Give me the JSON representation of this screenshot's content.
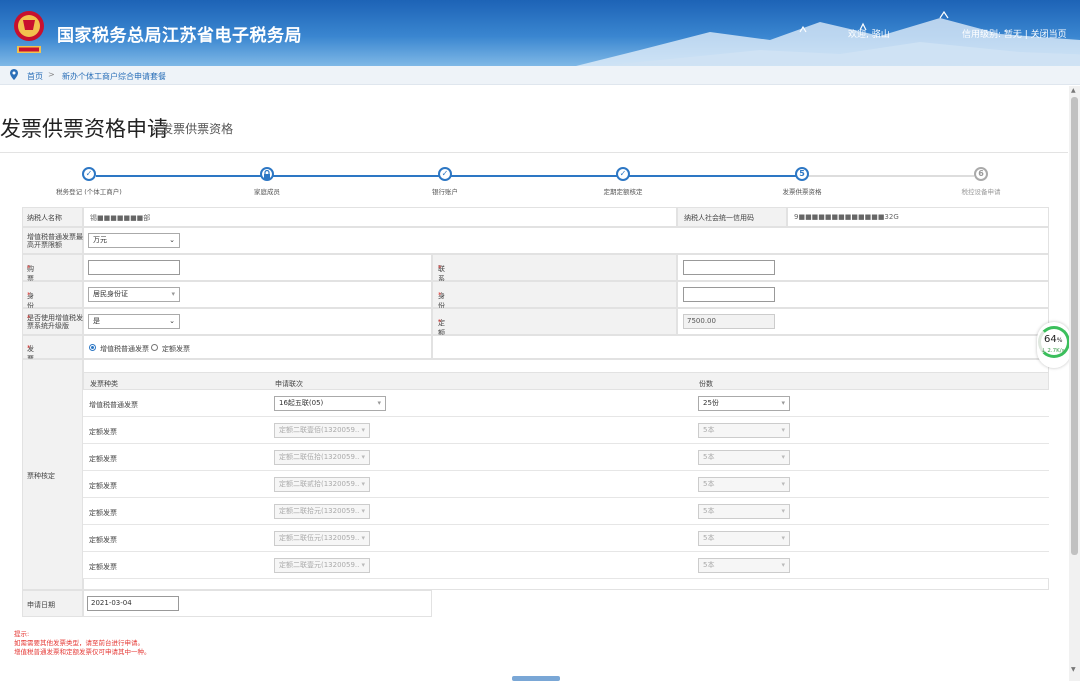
{
  "header": {
    "site_title": "国家税务总局江苏省电子税务局",
    "welcome": "欢迎, 骆山",
    "right_links": "信用级别: 暂无 | 关闭当页"
  },
  "breadcrumb": {
    "home": "首页",
    "separator": ">",
    "current": "新办个体工商户综合申请套餐"
  },
  "page": {
    "title": "发票供票资格申请",
    "subtitle": "» 发票供票资格"
  },
  "steps": [
    {
      "label": "税务登记 (个体工商户)",
      "mark": "✓",
      "status": "done"
    },
    {
      "label": "家庭成员",
      "mark": "🔒",
      "status": "done"
    },
    {
      "label": "银行账户",
      "mark": "✓",
      "status": "done"
    },
    {
      "label": "定期定额核定",
      "mark": "✓",
      "status": "done"
    },
    {
      "label": "发票供票资格",
      "mark": "5",
      "status": "current"
    },
    {
      "label": "税控设备申请",
      "mark": "6",
      "status": "todo"
    }
  ],
  "form": {
    "taxpayer_name_label": "纳税人名称",
    "taxpayer_name_value": "锡■■■■■■■部",
    "credit_code_label": "纳税人社会统一信用码",
    "credit_code_value": "9■■■■■■■■■■■■■32G",
    "max_amount_label": "增值税普通发票最高开票限额",
    "max_amount_value": "万元",
    "buyer_name_label": "购票人员姓名",
    "phone_label": "联系电话",
    "id_type_label": "身份证件类型",
    "id_type_value": "居民身份证",
    "id_no_label": "身份证件号码",
    "vat_upgrade_label": "是否使用增值税发票系统升级版",
    "vat_upgrade_value": "是",
    "quota_total_label": "定额发票累计领用金额",
    "quota_total_value": "7500.00",
    "invoice_kind_label": "发票种类",
    "invoice_kind_opt1": "增值税普通发票",
    "invoice_kind_opt2": "定额发票",
    "ticket_type_label": "票种核定",
    "apply_date_label": "申请日期",
    "apply_date_value": "2021-03-04",
    "required_mark": "*"
  },
  "ticket_table": {
    "headers": [
      "发票种类",
      "申请联次",
      "份数"
    ],
    "rows": [
      {
        "kind": "增值税普通发票",
        "copies": "16起五联(05)",
        "qty": "25份",
        "disabled": false
      },
      {
        "kind": "定额发票",
        "copies": "定额二联壹佰(1320059...",
        "qty": "5本",
        "disabled": true
      },
      {
        "kind": "定额发票",
        "copies": "定额二联伍拾(1320059...",
        "qty": "5本",
        "disabled": true
      },
      {
        "kind": "定额发票",
        "copies": "定额二联贰拾(1320059...",
        "qty": "5本",
        "disabled": true
      },
      {
        "kind": "定额发票",
        "copies": "定额二联拾元(1320059...",
        "qty": "5本",
        "disabled": true
      },
      {
        "kind": "定额发票",
        "copies": "定额二联伍元(1320059...",
        "qty": "5本",
        "disabled": true
      },
      {
        "kind": "定额发票",
        "copies": "定额二联壹元(1320059...",
        "qty": "5本",
        "disabled": true
      }
    ]
  },
  "tips": {
    "title": "提示:",
    "line1": "如需需要其他发票类型，请至前台进行申请。",
    "line2": "增值税普通发票和定额发票仅可申请其中一种。"
  },
  "speed_widget": {
    "percent": "64",
    "percent_unit": "%",
    "rate": "↓ 2.7K/s"
  },
  "colors": {
    "accent": "#2d77c4",
    "required": "#e53935",
    "header_top": "#1d63b6"
  }
}
